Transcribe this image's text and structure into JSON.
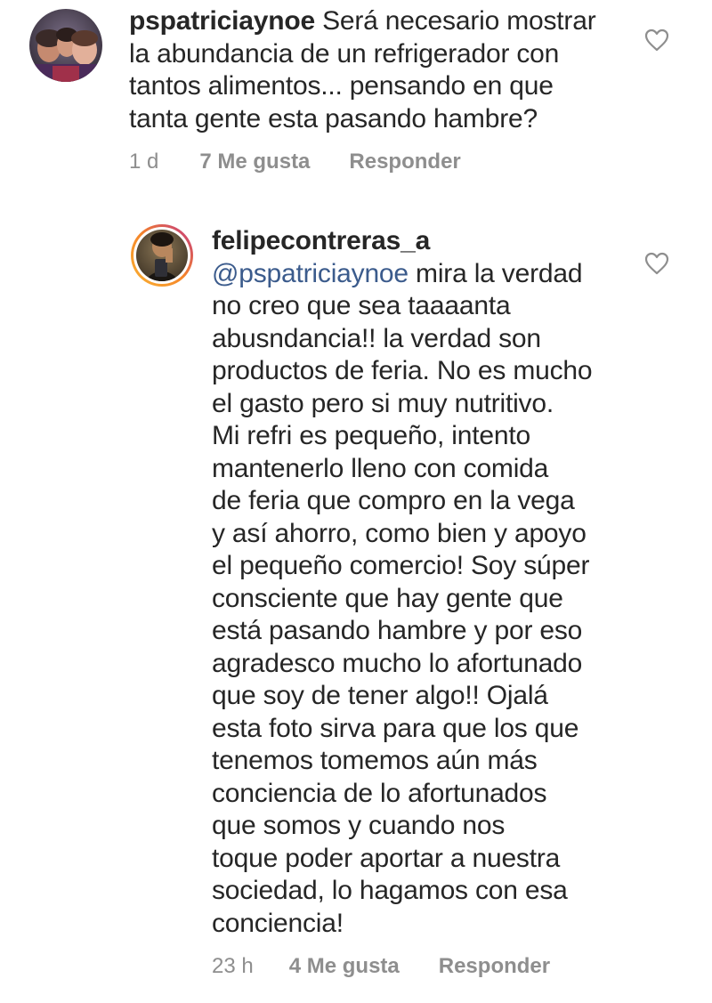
{
  "comments": [
    {
      "username": "pspatriciaynoe",
      "lines": [
        " Será necesario mostrar",
        "la abundancia de un refrigerador con",
        "tantos alimentos... pensando en que",
        "tanta gente esta pasando hambre?"
      ],
      "time": "1 d",
      "likes": "7 Me gusta",
      "reply": "Responder"
    },
    {
      "username": "felipecontreras_a",
      "mention": "@pspatriciaynoe",
      "lines": [
        " mira la verdad",
        "no creo que sea taaaanta",
        "abusndancia!! la verdad son",
        "productos de feria. No es mucho",
        "el gasto pero si muy nutritivo.",
        "Mi refri es pequeño, intento",
        "mantenerlo lleno con comida",
        "de feria que compro en la vega",
        "y así ahorro, como bien y apoyo",
        "el pequeño comercio! Soy súper",
        "consciente que hay gente que",
        "está pasando hambre y por eso",
        "agradesco mucho lo afortunado",
        "que soy de tener algo!! Ojalá",
        "esta foto sirva para que los que",
        "tenemos tomemos aún más",
        "conciencia de lo afortunados",
        "que somos y cuando nos",
        "toque poder aportar a nuestra",
        "sociedad, lo hagamos con esa",
        "conciencia!"
      ],
      "time": "23 h",
      "likes": "4 Me gusta",
      "reply": "Responder"
    }
  ],
  "icons": {
    "like": "heart-outline-icon",
    "avatar_ring": "story-ring"
  },
  "colors": {
    "text": "#262626",
    "meta": "#8e8e8e",
    "mention": "#3b5b8c",
    "ring_start": "#f58529",
    "ring_end": "#dd2a7b"
  }
}
